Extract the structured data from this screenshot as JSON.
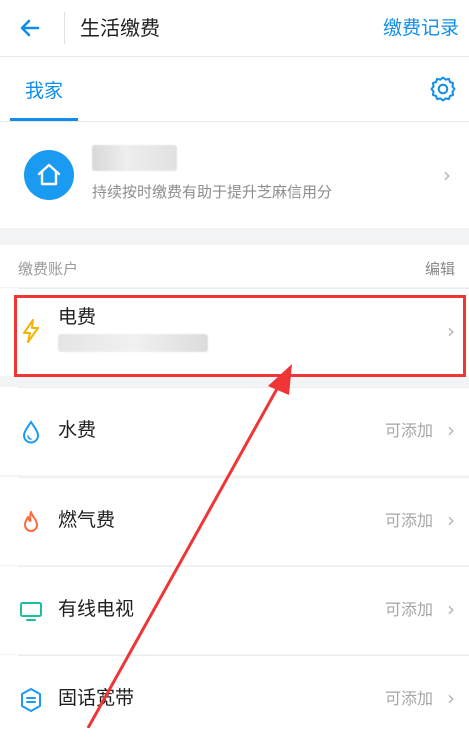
{
  "header": {
    "title": "生活缴费",
    "link_label": "缴费记录"
  },
  "tabs": [
    {
      "label": "我家",
      "active": true
    }
  ],
  "home": {
    "subtitle": "持续按时缴费有助于提升芝麻信用分"
  },
  "section": {
    "label": "缴费账户",
    "edit_label": "编辑"
  },
  "bills": [
    {
      "label": "电费",
      "status": "",
      "icon": "lightning-icon",
      "color": "#f5b400"
    },
    {
      "label": "水费",
      "status": "可添加",
      "icon": "water-drop-icon",
      "color": "#1a9af0"
    },
    {
      "label": "燃气费",
      "status": "可添加",
      "icon": "flame-icon",
      "color": "#ff6a3d"
    },
    {
      "label": "有线电视",
      "status": "可添加",
      "icon": "tv-icon",
      "color": "#1bbf9c"
    },
    {
      "label": "固话宽带",
      "status": "可添加",
      "icon": "broadband-icon",
      "color": "#1a9af0"
    }
  ],
  "colors": {
    "accent": "#108ee9",
    "highlight": "#ef3535"
  }
}
